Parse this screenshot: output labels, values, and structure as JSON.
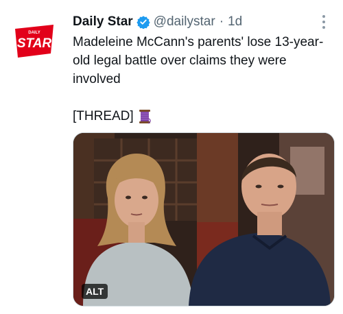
{
  "tweet": {
    "author_name": "Daily Star",
    "handle": "@dailystar",
    "separator": "·",
    "time": "1d",
    "logo": {
      "small_text": "DAILY",
      "big_text": "STAR",
      "color": "#e2001a"
    },
    "text_line": "Madeleine McCann's parents' lose 13-year-old legal battle over claims they were involved",
    "thread_label": "[THREAD]",
    "thread_icon": "spool-of-thread-icon",
    "media": {
      "alt_badge": "ALT"
    },
    "colors": {
      "text": "#0f1419",
      "secondary": "#536471",
      "verified": "#1d9bf0"
    }
  }
}
